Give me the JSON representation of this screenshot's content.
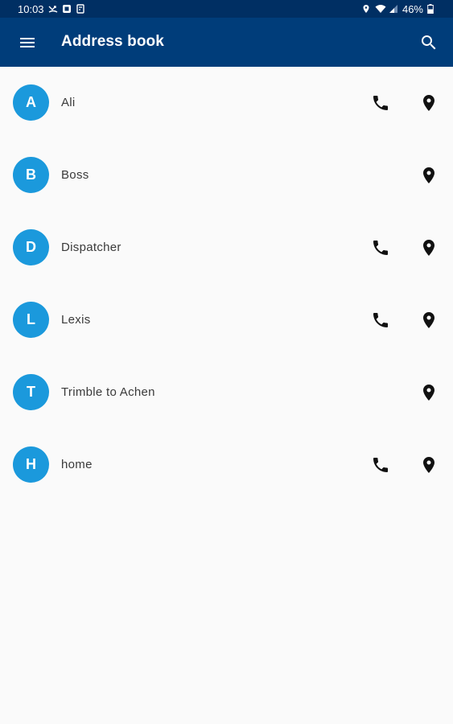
{
  "status_bar": {
    "time": "10:03",
    "battery": "46%",
    "left_icons": [
      "phone-missed-icon",
      "notification-icon",
      "screenshot-icon"
    ],
    "right_icons": [
      "location-icon",
      "wifi-icon",
      "signal-icon",
      "battery-icon"
    ]
  },
  "app_bar": {
    "title": "Address book",
    "menu_icon": "menu-icon",
    "search_icon": "search-icon"
  },
  "colors": {
    "status_bar": "#002f63",
    "app_bar": "#003d7a",
    "avatar": "#1b99dc",
    "background": "#fafafa"
  },
  "contacts": [
    {
      "initial": "A",
      "name": "Ali",
      "has_phone": true,
      "has_location": true
    },
    {
      "initial": "B",
      "name": "Boss",
      "has_phone": false,
      "has_location": true
    },
    {
      "initial": "D",
      "name": "Dispatcher",
      "has_phone": true,
      "has_location": true
    },
    {
      "initial": "L",
      "name": "Lexis",
      "has_phone": true,
      "has_location": true
    },
    {
      "initial": "T",
      "name": "Trimble to Achen",
      "has_phone": false,
      "has_location": true
    },
    {
      "initial": "H",
      "name": "home",
      "has_phone": true,
      "has_location": true
    }
  ]
}
